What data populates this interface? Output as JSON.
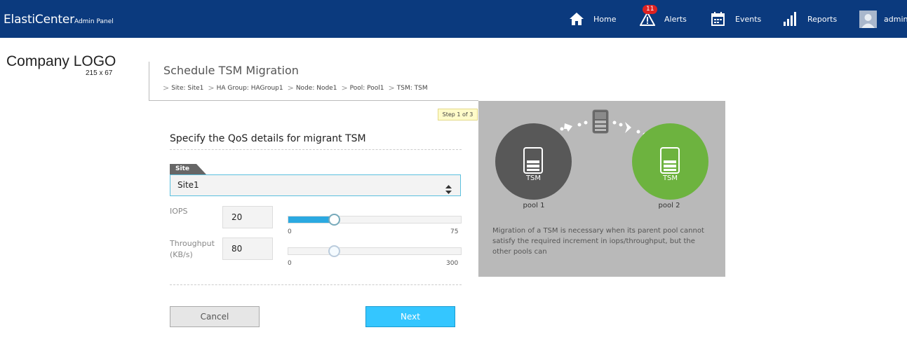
{
  "brand": {
    "name": "ElastiCenter",
    "sub": "Admin Panel"
  },
  "nav": {
    "home": "Home",
    "alerts": "Alerts",
    "alerts_badge": "11",
    "events": "Events",
    "reports": "Reports",
    "user": "admin"
  },
  "logo": {
    "title": "Company LOGO",
    "size": "215 x 67"
  },
  "page": {
    "title": "Schedule TSM Migration",
    "breadcrumb": [
      "Site: Site1",
      "HA Group: HAGroup1",
      "Node: Node1",
      "Pool: Pool1",
      "TSM: TSM"
    ],
    "step": "Step 1 of 3"
  },
  "form": {
    "title": "Specify the QoS details for migrant TSM",
    "site_label": "Site",
    "site_value": "Site1",
    "iops_label": "IOPS",
    "iops_value": "20",
    "iops_min": "0",
    "iops_max": "75",
    "iops_fraction": 0.267,
    "throughput_label": "Throughput (KB/s)",
    "throughput_value": "80",
    "throughput_min": "0",
    "throughput_max": "300",
    "throughput_fraction": 0.267,
    "cancel_label": "Cancel",
    "next_label": "Next"
  },
  "diagram": {
    "pool1_label": "pool 1",
    "pool2_label": "pool 2",
    "tsm_label": "TSM",
    "description": "Migration of a TSM is necessary when its parent pool cannot satisfy the required increment in iops/throughput, but the other pools can"
  },
  "colors": {
    "topbar": "#0b3a7e",
    "accent": "#34c6ff",
    "pool1": "#585858",
    "pool2": "#6db33f",
    "badge": "#dd2222"
  }
}
